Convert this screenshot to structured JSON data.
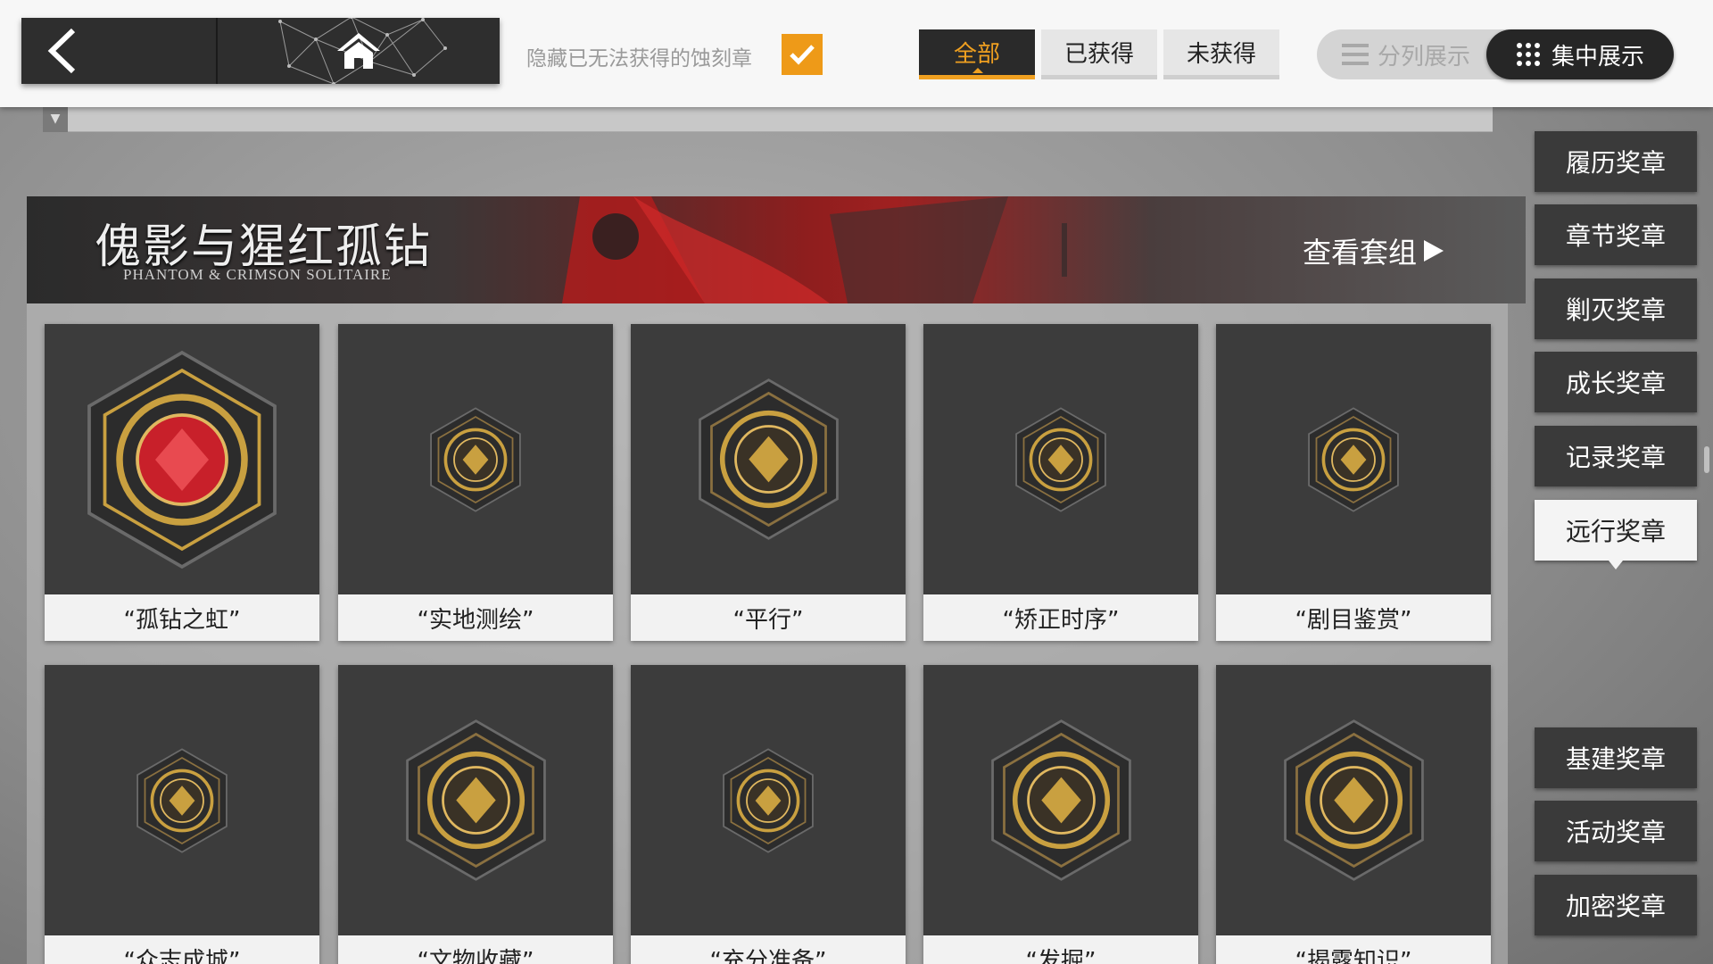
{
  "topbar": {
    "hide_label": "隐藏已无法获得的蚀刻章",
    "hide_checked": true,
    "tabs": [
      {
        "label": "全部",
        "active": true
      },
      {
        "label": "已获得",
        "active": false
      },
      {
        "label": "未获得",
        "active": false
      }
    ],
    "view_split_label": "分列展示",
    "view_focus_label": "集中展示"
  },
  "banner": {
    "title": "傀影与猩红孤钻",
    "subtitle": "PHANTOM & CRIMSON SOLITAIRE",
    "link_label": "查看套组"
  },
  "medals": [
    {
      "name": "“孤钻之虹”",
      "icon": "crimson-gem-medal-icon",
      "color": "#c8202a"
    },
    {
      "name": "“实地测绘”",
      "icon": "field-surveying-medal-icon",
      "color": "#c9a040"
    },
    {
      "name": "“平行”",
      "icon": "parallel-rook-medal-icon",
      "color": "#c9a040"
    },
    {
      "name": "“矫正时序”",
      "icon": "compass-clock-medal-icon",
      "color": "#c9a040"
    },
    {
      "name": "“剧目鉴赏”",
      "icon": "scarlet-troupe-medal-icon",
      "color": "#c9a040"
    },
    {
      "name": "“众志成城”",
      "icon": "wheel-40-medal-icon",
      "color": "#c9a040"
    },
    {
      "name": "“文物收藏”",
      "icon": "mask-relic-medal-icon",
      "color": "#c9a040"
    },
    {
      "name": "“充分准备”",
      "icon": "professional-team-medal-icon",
      "color": "#c9a040"
    },
    {
      "name": "“发掘”",
      "icon": "excavate-medal-icon",
      "color": "#c9a040"
    },
    {
      "name": "“揭露知识”",
      "icon": "skull-card-medal-icon",
      "color": "#c9a040"
    }
  ],
  "categories_top": [
    {
      "label": "履历奖章",
      "active": false
    },
    {
      "label": "章节奖章",
      "active": false
    },
    {
      "label": "剿灭奖章",
      "active": false
    },
    {
      "label": "成长奖章",
      "active": false
    },
    {
      "label": "记录奖章",
      "active": false
    },
    {
      "label": "远行奖章",
      "active": true
    }
  ],
  "categories_bottom": [
    {
      "label": "基建奖章",
      "active": false
    },
    {
      "label": "活动奖章",
      "active": false
    },
    {
      "label": "加密奖章",
      "active": false
    }
  ],
  "colors": {
    "accent": "#f0a020",
    "card_bg": "#3c3c3c",
    "gold": "#c9a040"
  }
}
